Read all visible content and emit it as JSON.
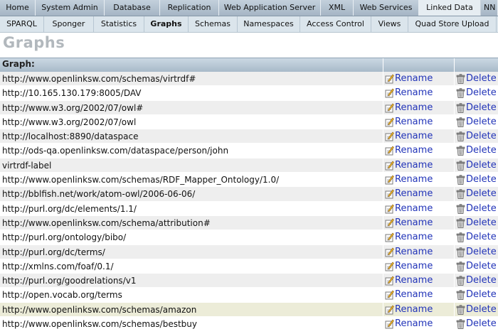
{
  "tabs": [
    {
      "label": "Home"
    },
    {
      "label": "System Admin"
    },
    {
      "label": "Database"
    },
    {
      "label": "Replication"
    },
    {
      "label": "Web Application Server"
    },
    {
      "label": "XML"
    },
    {
      "label": "Web Services"
    },
    {
      "label": "Linked Data"
    },
    {
      "label": "NN"
    }
  ],
  "subtabs": [
    {
      "label": "SPARQL"
    },
    {
      "label": "Sponger"
    },
    {
      "label": "Statistics"
    },
    {
      "label": "Graphs"
    },
    {
      "label": "Schemas"
    },
    {
      "label": "Namespaces"
    },
    {
      "label": "Access Control"
    },
    {
      "label": "Views"
    },
    {
      "label": "Quad Store Upload"
    }
  ],
  "page_title": "Graphs",
  "table": {
    "header": "Graph:",
    "rename_label": "Rename",
    "delete_label": "Delete",
    "rows": [
      {
        "graph": "http://www.openlinksw.com/schemas/virtrdf#"
      },
      {
        "graph": "http://10.165.130.179:8005/DAV"
      },
      {
        "graph": "http://www.w3.org/2002/07/owl#"
      },
      {
        "graph": "http://www.w3.org/2002/07/owl"
      },
      {
        "graph": "http://localhost:8890/dataspace"
      },
      {
        "graph": "http://ods-qa.openlinksw.com/dataspace/person/john"
      },
      {
        "graph": "virtrdf-label"
      },
      {
        "graph": "http://www.openlinksw.com/schemas/RDF_Mapper_Ontology/1.0/"
      },
      {
        "graph": "http://bblfish.net/work/atom-owl/2006-06-06/"
      },
      {
        "graph": "http://purl.org/dc/elements/1.1/"
      },
      {
        "graph": "http://www.openlinksw.com/schema/attribution#"
      },
      {
        "graph": "http://purl.org/ontology/bibo/"
      },
      {
        "graph": "http://purl.org/dc/terms/"
      },
      {
        "graph": "http://xmlns.com/foaf/0.1/"
      },
      {
        "graph": "http://purl.org/goodrelations/v1"
      },
      {
        "graph": "http://open.vocab.org/terms"
      },
      {
        "graph": "http://www.openlinksw.com/schemas/amazon"
      },
      {
        "graph": "http://www.openlinksw.com/schemas/bestbuy"
      }
    ]
  }
}
